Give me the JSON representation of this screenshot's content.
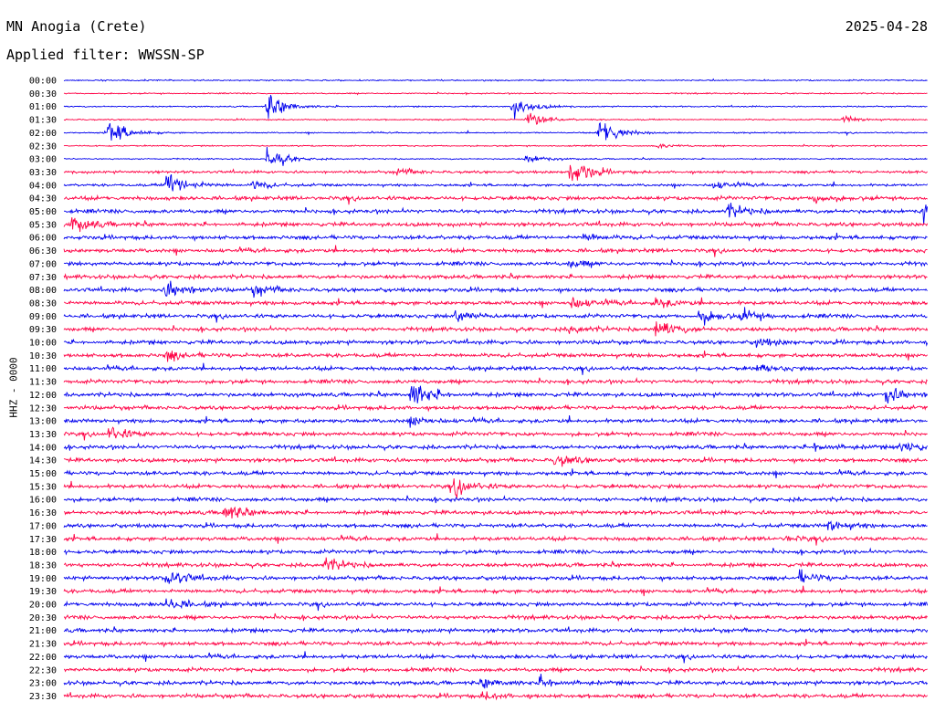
{
  "header": {
    "station": "MN Anogia (Crete)",
    "date": "2025-04-28",
    "filter": "Applied filter: WWSSN-SP"
  },
  "chart_data": {
    "type": "line",
    "title": "MN Anogia (Crete)",
    "ylabel": "HHZ - 0000",
    "xlabel": "",
    "line_labels": [
      "00:00",
      "00:30",
      "01:00",
      "01:30",
      "02:00",
      "02:30",
      "03:00",
      "03:30",
      "04:00",
      "04:30",
      "05:00",
      "05:30",
      "06:00",
      "06:30",
      "07:00",
      "07:30",
      "08:00",
      "08:30",
      "09:00",
      "09:30",
      "10:00",
      "10:30",
      "11:00",
      "11:30",
      "12:00",
      "12:30",
      "13:00",
      "13:30",
      "14:00",
      "14:30",
      "15:00",
      "15:30",
      "16:00",
      "16:30",
      "17:00",
      "17:30",
      "18:00",
      "18:30",
      "19:00",
      "19:30",
      "20:00",
      "20:30",
      "21:00",
      "21:30",
      "22:00",
      "22:30",
      "23:00",
      "23:30"
    ],
    "series_colors": [
      "#0000ee",
      "#ff0044"
    ],
    "line_minutes": 30,
    "noise_amplitude": [
      1,
      1,
      1,
      1,
      1,
      1,
      1,
      2,
      2,
      3,
      3,
      3,
      3,
      3,
      3,
      3,
      3,
      3,
      3,
      3,
      3,
      3,
      3,
      3,
      3,
      3,
      3,
      3,
      3,
      3,
      3,
      3,
      3,
      3,
      3,
      3,
      3,
      3,
      3,
      3,
      3,
      3,
      3,
      3,
      3,
      3,
      3,
      3
    ],
    "events": [
      {
        "line": 2,
        "minute": 7.0,
        "amplitude": 25
      },
      {
        "line": 2,
        "minute": 15.5,
        "amplitude": 18
      },
      {
        "line": 3,
        "minute": 16.0,
        "amplitude": 14
      },
      {
        "line": 3,
        "minute": 27.0,
        "amplitude": 6
      },
      {
        "line": 4,
        "minute": 1.5,
        "amplitude": 24
      },
      {
        "line": 4,
        "minute": 18.5,
        "amplitude": 30
      },
      {
        "line": 5,
        "minute": 20.5,
        "amplitude": 4
      },
      {
        "line": 6,
        "minute": 7.0,
        "amplitude": 20
      },
      {
        "line": 6,
        "minute": 16.0,
        "amplitude": 8
      },
      {
        "line": 7,
        "minute": 11.5,
        "amplitude": 6
      },
      {
        "line": 7,
        "minute": 17.5,
        "amplitude": 24
      },
      {
        "line": 8,
        "minute": 3.5,
        "amplitude": 28
      },
      {
        "line": 8,
        "minute": 6.5,
        "amplitude": 8
      },
      {
        "line": 8,
        "minute": 22.5,
        "amplitude": 7
      },
      {
        "line": 9,
        "minute": 26.0,
        "amplitude": 8
      },
      {
        "line": 10,
        "minute": 23.0,
        "amplitude": 12
      },
      {
        "line": 10,
        "minute": 29.8,
        "amplitude": 22
      },
      {
        "line": 11,
        "minute": 0.2,
        "amplitude": 14
      },
      {
        "line": 12,
        "minute": 18.0,
        "amplitude": 6
      },
      {
        "line": 14,
        "minute": 17.5,
        "amplitude": 6
      },
      {
        "line": 16,
        "minute": 3.5,
        "amplitude": 18
      },
      {
        "line": 16,
        "minute": 6.5,
        "amplitude": 10
      },
      {
        "line": 17,
        "minute": 17.5,
        "amplitude": 12
      },
      {
        "line": 17,
        "minute": 20.5,
        "amplitude": 8
      },
      {
        "line": 18,
        "minute": 13.5,
        "amplitude": 12
      },
      {
        "line": 18,
        "minute": 23.5,
        "amplitude": 10
      },
      {
        "line": 18,
        "minute": 22.0,
        "amplitude": 14
      },
      {
        "line": 19,
        "minute": 20.5,
        "amplitude": 18
      },
      {
        "line": 19,
        "minute": 17.5,
        "amplitude": 6
      },
      {
        "line": 20,
        "minute": 24.0,
        "amplitude": 7
      },
      {
        "line": 21,
        "minute": 3.5,
        "amplitude": 8
      },
      {
        "line": 22,
        "minute": 24.0,
        "amplitude": 6
      },
      {
        "line": 24,
        "minute": 12.0,
        "amplitude": 24
      },
      {
        "line": 24,
        "minute": 28.5,
        "amplitude": 14
      },
      {
        "line": 26,
        "minute": 12.0,
        "amplitude": 8
      },
      {
        "line": 27,
        "minute": 1.5,
        "amplitude": 12
      },
      {
        "line": 28,
        "minute": 26.0,
        "amplitude": 8
      },
      {
        "line": 28,
        "minute": 29.0,
        "amplitude": 10
      },
      {
        "line": 29,
        "minute": 17.0,
        "amplitude": 12
      },
      {
        "line": 31,
        "minute": 13.5,
        "amplitude": 14
      },
      {
        "line": 33,
        "minute": 5.5,
        "amplitude": 16
      },
      {
        "line": 34,
        "minute": 26.5,
        "amplitude": 10
      },
      {
        "line": 35,
        "minute": 25.0,
        "amplitude": 4
      },
      {
        "line": 37,
        "minute": 9.0,
        "amplitude": 12
      },
      {
        "line": 38,
        "minute": 25.5,
        "amplitude": 10
      },
      {
        "line": 38,
        "minute": 3.5,
        "amplitude": 14
      },
      {
        "line": 40,
        "minute": 3.5,
        "amplitude": 12
      },
      {
        "line": 46,
        "minute": 14.5,
        "amplitude": 8
      },
      {
        "line": 46,
        "minute": 16.5,
        "amplitude": 10
      },
      {
        "line": 47,
        "minute": 14.5,
        "amplitude": 6
      }
    ]
  },
  "colors": {
    "blue": "#0000ee",
    "red": "#ff0044",
    "background": "#ffffff",
    "text": "#000000"
  }
}
